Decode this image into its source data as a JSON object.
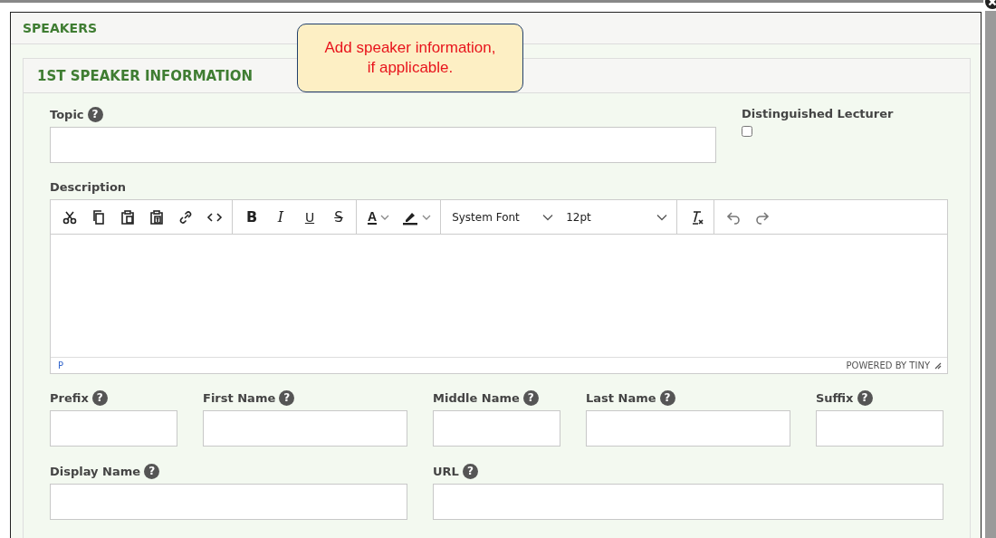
{
  "section": {
    "title": "SPEAKERS"
  },
  "callout": {
    "text_lines": [
      "Add speaker information,",
      "if applicable."
    ]
  },
  "card": {
    "title": "1ST SPEAKER INFORMATION"
  },
  "topic": {
    "label": "Topic",
    "help": "?"
  },
  "distinguished_lecturer": {
    "label": "Distinguished Lecturer",
    "checked": false
  },
  "description": {
    "label": "Description",
    "format_buttons": [
      {
        "kind": "bold",
        "label": "B"
      },
      {
        "kind": "italic",
        "label": "I"
      },
      {
        "kind": "underline",
        "label": "U"
      },
      {
        "kind": "strike",
        "label": "S"
      }
    ],
    "text_color": {
      "label": "A"
    },
    "font_family": "System Font",
    "font_size": "12pt",
    "path": "P",
    "branding": "POWERED BY TINY"
  },
  "name_fields": [
    {
      "label": "Prefix",
      "help": "?"
    },
    {
      "label": "First Name",
      "help": "?"
    },
    {
      "label": "Middle Name",
      "help": "?"
    },
    {
      "label": "Last Name",
      "help": "?"
    },
    {
      "label": "Suffix",
      "help": "?"
    }
  ],
  "extra_fields": [
    {
      "label": "Display Name",
      "help": "?"
    },
    {
      "label": "URL",
      "help": "?"
    }
  ]
}
